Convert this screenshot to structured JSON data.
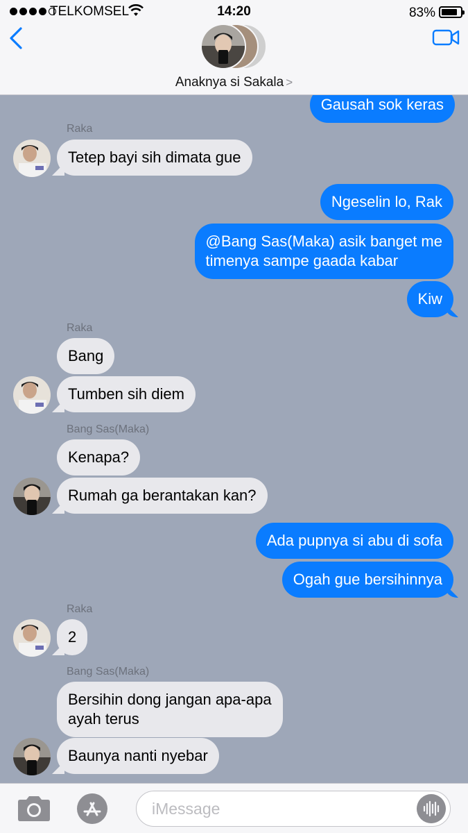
{
  "status_bar": {
    "carrier": "TELKOMSEL",
    "time": "14:20",
    "battery_percent": "83%",
    "signal_bars_filled": 4,
    "signal_bars_total": 5
  },
  "header": {
    "group_name": "Anaknya si Sakala",
    "chevron": ">",
    "back_icon": "chevron-left-icon",
    "video_icon": "video-camera-icon"
  },
  "messages": [
    {
      "type": "outgoing",
      "text": "Gausah sok keras"
    },
    {
      "type": "sender",
      "text": "Raka"
    },
    {
      "type": "incoming",
      "text": "Tetep bayi sih dimata gue"
    },
    {
      "type": "outgoing",
      "text": "Ngeselin lo, Rak"
    },
    {
      "type": "outgoing",
      "lines": [
        "@Bang Sas(Maka) asik banget me",
        "timenya sampe gaada kabar"
      ]
    },
    {
      "type": "outgoing",
      "text": "Kiw"
    },
    {
      "type": "sender",
      "text": "Raka"
    },
    {
      "type": "incoming",
      "text": "Bang"
    },
    {
      "type": "incoming",
      "text": "Tumben sih diem"
    },
    {
      "type": "sender",
      "text": "Bang Sas(Maka)"
    },
    {
      "type": "incoming",
      "text": "Kenapa?"
    },
    {
      "type": "incoming",
      "text": "Rumah ga berantakan kan?"
    },
    {
      "type": "outgoing",
      "text": "Ada pupnya si abu di sofa"
    },
    {
      "type": "outgoing",
      "text": "Ogah gue bersihinnya"
    },
    {
      "type": "sender",
      "text": "Raka"
    },
    {
      "type": "incoming",
      "text": "2"
    },
    {
      "type": "sender",
      "text": "Bang Sas(Maka)"
    },
    {
      "type": "incoming",
      "lines": [
        "Bersihin dong jangan apa-apa",
        "ayah terus"
      ]
    },
    {
      "type": "incoming",
      "text": "Baunya nanti nyebar"
    }
  ],
  "input_bar": {
    "placeholder": "iMessage",
    "camera_icon": "camera-icon",
    "appstore_icon": "app-store-icon",
    "audio_icon": "audio-waveform-icon"
  },
  "colors": {
    "chat_background": "#9ea7b8",
    "outgoing_bubble": "#0a7cff",
    "incoming_bubble": "#e8e8ec",
    "accent": "#0a7cff"
  }
}
